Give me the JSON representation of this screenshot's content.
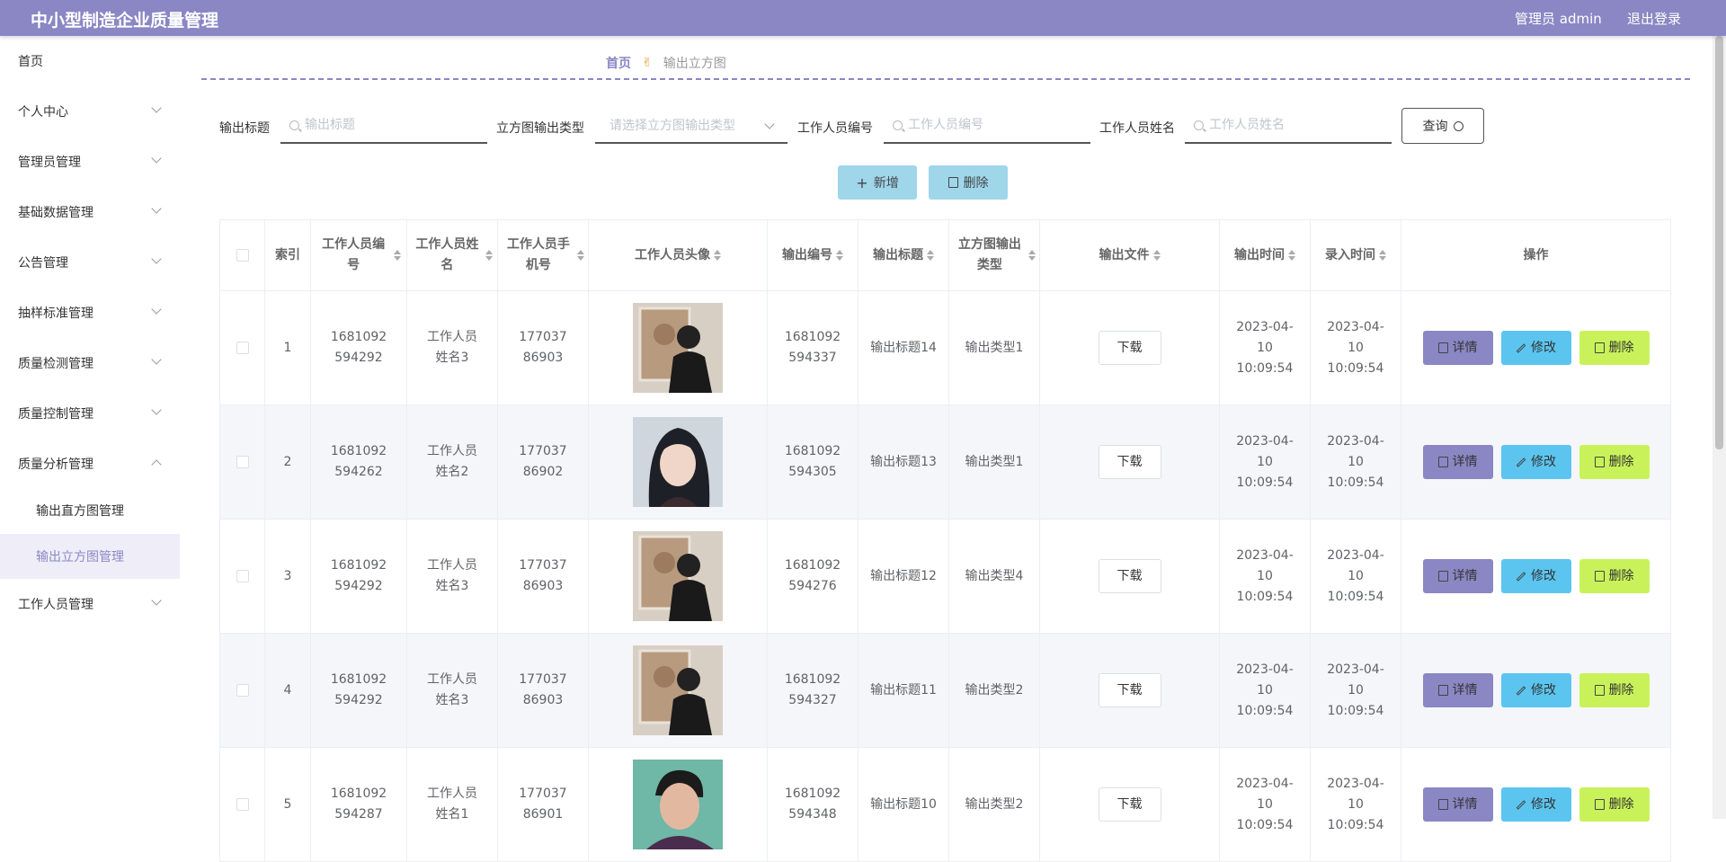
{
  "app": {
    "title": "中小型制造企业质量管理",
    "admin": "管理员 admin",
    "logout": "退出登录"
  },
  "sidebar": {
    "items": [
      {
        "label": "首页"
      },
      {
        "label": "个人中心"
      },
      {
        "label": "管理员管理"
      },
      {
        "label": "基础数据管理"
      },
      {
        "label": "公告管理"
      },
      {
        "label": "抽样标准管理"
      },
      {
        "label": "质量检测管理"
      },
      {
        "label": "质量控制管理"
      },
      {
        "label": "质量分析管理"
      },
      {
        "label": "工作人员管理"
      }
    ],
    "sub_items": [
      {
        "label": "输出直方图管理"
      },
      {
        "label": "输出立方图管理"
      }
    ]
  },
  "breadcrumb": {
    "home": "首页",
    "separator": "✌",
    "current": "输出立方图"
  },
  "search": {
    "title_label": "输出标题",
    "title_placeholder": "输出标题",
    "type_label": "立方图输出类型",
    "type_placeholder": "请选择立方图输出类型",
    "staff_no_label": "工作人员编号",
    "staff_no_placeholder": "工作人员编号",
    "staff_name_label": "工作人员姓名",
    "staff_name_placeholder": "工作人员姓名",
    "query_button": "查询"
  },
  "actions": {
    "add": "新增",
    "delete": "删除"
  },
  "table": {
    "headers": [
      "索引",
      "工作人员编号",
      "工作人员姓名",
      "工作人员手机号",
      "工作人员头像",
      "输出编号",
      "输出标题",
      "立方图输出类型",
      "输出文件",
      "输出时间",
      "录入时间",
      "操作"
    ],
    "download": "下载",
    "ops": {
      "detail": "详情",
      "edit": "修改",
      "delete": "删除"
    },
    "rows": [
      {
        "index": "1",
        "staff_no": "1681092594292",
        "staff_name": "工作人员姓名3",
        "phone": "17703786903",
        "avatar": "photo-back-view",
        "out_no": "1681092594337",
        "title": "输出标题14",
        "type": "输出类型1",
        "out_time": "2023-04-10 10:09:54",
        "entry_time": "2023-04-10 10:09:54"
      },
      {
        "index": "2",
        "staff_no": "1681092594262",
        "staff_name": "工作人员姓名2",
        "phone": "17703786902",
        "avatar": "photo-girl-portrait",
        "out_no": "1681092594305",
        "title": "输出标题13",
        "type": "输出类型1",
        "out_time": "2023-04-10 10:09:54",
        "entry_time": "2023-04-10 10:09:54"
      },
      {
        "index": "3",
        "staff_no": "1681092594292",
        "staff_name": "工作人员姓名3",
        "phone": "17703786903",
        "avatar": "photo-back-view",
        "out_no": "1681092594276",
        "title": "输出标题12",
        "type": "输出类型4",
        "out_time": "2023-04-10 10:09:54",
        "entry_time": "2023-04-10 10:09:54"
      },
      {
        "index": "4",
        "staff_no": "1681092594292",
        "staff_name": "工作人员姓名3",
        "phone": "17703786903",
        "avatar": "photo-back-view",
        "out_no": "1681092594327",
        "title": "输出标题11",
        "type": "输出类型2",
        "out_time": "2023-04-10 10:09:54",
        "entry_time": "2023-04-10 10:09:54"
      },
      {
        "index": "5",
        "staff_no": "1681092594287",
        "staff_name": "工作人员姓名1",
        "phone": "17703786901",
        "avatar": "photo-man-portrait",
        "out_no": "1681092594348",
        "title": "输出标题10",
        "type": "输出类型2",
        "out_time": "2023-04-10 10:09:54",
        "entry_time": "2023-04-10 10:09:54"
      }
    ]
  },
  "colors": {
    "primary": "#8a87c4",
    "edit": "#5bc5f0",
    "delete": "#c9f25a",
    "action": "#9fd6ea"
  }
}
